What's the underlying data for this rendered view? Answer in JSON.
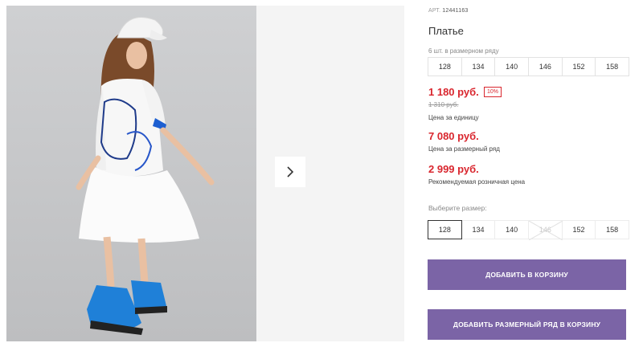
{
  "product": {
    "sku_label": "АРТ.",
    "sku": "12441163",
    "title": "Платье",
    "pack_label": "6 шт. в размерном ряду",
    "pack_sizes": [
      "128",
      "134",
      "140",
      "146",
      "152",
      "158"
    ],
    "unit_price": "1 180 руб.",
    "discount": "10%",
    "old_price": "1 310 руб.",
    "unit_price_caption": "Цена за единицу",
    "pack_price": "7 080 руб.",
    "pack_price_caption": "Цена за размерный ряд",
    "retail_price": "2 999 руб.",
    "retail_price_caption": "Рекомендуемая розничная цена",
    "size_label": "Выберите размер:",
    "sizes": [
      {
        "label": "128",
        "state": "selected"
      },
      {
        "label": "134",
        "state": "available"
      },
      {
        "label": "140",
        "state": "available"
      },
      {
        "label": "146",
        "state": "unavailable"
      },
      {
        "label": "152",
        "state": "available"
      },
      {
        "label": "158",
        "state": "available"
      }
    ],
    "add_to_cart": "ДОБАВИТЬ В КОРЗИНУ",
    "add_pack_to_cart": "ДОБАВИТЬ РАЗМЕРНЫЙ РЯД В КОРЗИНУ"
  },
  "gallery": {
    "next_icon": "chevron-right-icon"
  },
  "colors": {
    "price": "#d9262e",
    "button": "#7b64a6",
    "photo_bg": "#c8c9cb"
  }
}
